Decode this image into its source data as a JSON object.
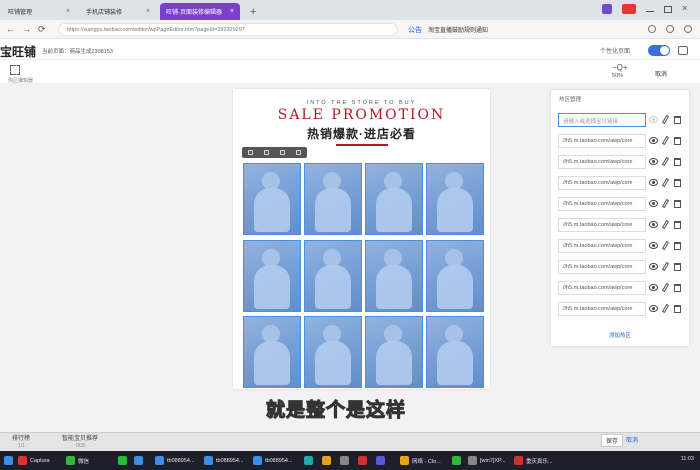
{
  "browser": {
    "tabs": [
      {
        "label": "旺铺管理",
        "active": false
      },
      {
        "label": "手机店铺装修",
        "active": false
      },
      {
        "label": "旺铺-页面装修编辑器",
        "active": true
      }
    ],
    "new_tab_label": "+",
    "url": "https://xiangyu.taobao.com/editor/wpPageEditor.htm?pageId=392329297",
    "notice_tag": "公告",
    "notice_text": "淘宝直播鼓励规则通知"
  },
  "app": {
    "brand": "宝旺铺",
    "shop_label": "当前页面：商品生成2308153",
    "personal_label": "个性化页面"
  },
  "toolbar": {
    "hotspot_editor_label": "热区编辑器",
    "zoom_icon": "−Q+",
    "zoom_value": "50%",
    "cancel": "取消"
  },
  "canvas": {
    "into_text": "INTO THE STORE TO BUY",
    "sale_text": "SALE PROMOTION",
    "hot_text": "热销爆款·进店必看"
  },
  "panel": {
    "title": "热区管理",
    "placeholder": "请输入或选择宝贝链接",
    "links": [
      "//h5.m.taobao.com/awp/core",
      "//h5.m.taobao.com/awp/core",
      "//h5.m.taobao.com/awp/core",
      "//h5.m.taobao.com/awp/core",
      "//h5.m.taobao.com/awp/core",
      "//h5.m.taobao.com/awp/core",
      "//h5.m.taobao.com/awp/core",
      "//h5.m.taobao.com/awp/core",
      "//h5.m.taobao.com/awp/core"
    ],
    "add_hotspot": "添加热区"
  },
  "subtitle": "就是整个是这样",
  "bottom": {
    "tab1": "排行榜",
    "tab1_sub": "1/1",
    "tab2": "智能宝贝推荐",
    "tab2_sub": "0/35",
    "save": "保存",
    "cancel": "取消"
  },
  "taskbar": {
    "items": [
      {
        "label": "Captura",
        "color": "#d33"
      },
      {
        "label": "微信",
        "color": "#2dbb3b"
      },
      {
        "label": "tb088954...",
        "color": "#3a8ee6"
      },
      {
        "label": "tb088954...",
        "color": "#3a8ee6"
      },
      {
        "label": "tb088954...",
        "color": "#3a8ee6"
      },
      {
        "label": "网络 - Clo...",
        "color": "#e5a31a"
      },
      {
        "label": "[win7]XP...",
        "color": "#888"
      },
      {
        "label": "重庆真乐...",
        "color": "#c33"
      }
    ],
    "time": "11:03"
  }
}
